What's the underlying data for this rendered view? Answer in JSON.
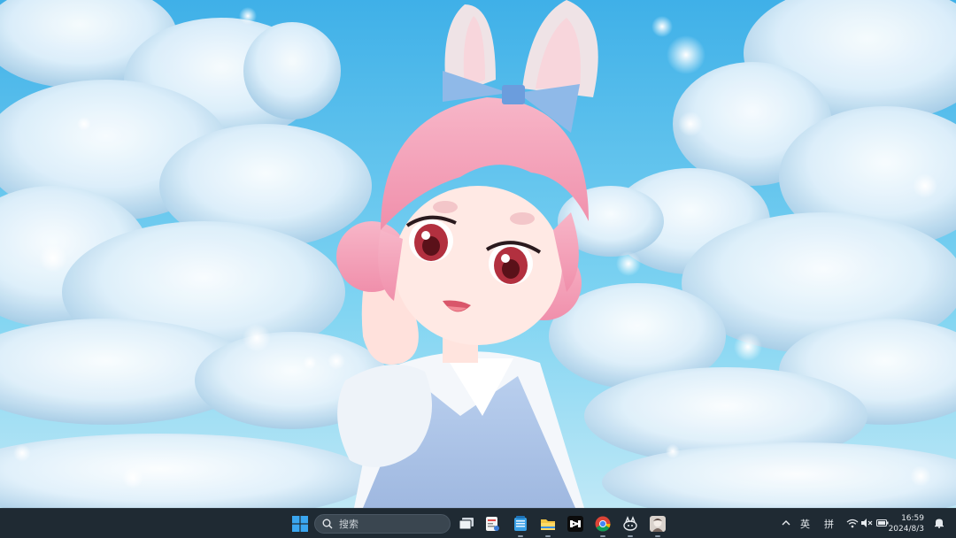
{
  "wallpaper": {
    "description_icon": "anime-bunny-girl-wallpaper"
  },
  "taskbar": {
    "search": {
      "placeholder": "搜索"
    },
    "apps": [
      {
        "name": "task-view",
        "icon": "task-view-icon"
      },
      {
        "name": "app-pinned-1",
        "icon": "notes-app-icon"
      },
      {
        "name": "notepad",
        "icon": "notepad-icon"
      },
      {
        "name": "file-explorer",
        "icon": "folder-icon"
      },
      {
        "name": "capcut",
        "icon": "capcut-icon"
      },
      {
        "name": "chrome",
        "icon": "chrome-icon"
      },
      {
        "name": "app-pinned-2",
        "icon": "pet-app-icon"
      },
      {
        "name": "app-pinned-3",
        "icon": "avatar-app-icon"
      }
    ],
    "tray": {
      "language": "英",
      "ime_mode": "拼",
      "time": "16:59",
      "date": "2024/8/3"
    }
  },
  "colors": {
    "taskbar_bg": "#1f2a33",
    "sky": "#46b6ea",
    "hair": "#f5a3b8",
    "ribbon": "#8fb9e8"
  }
}
